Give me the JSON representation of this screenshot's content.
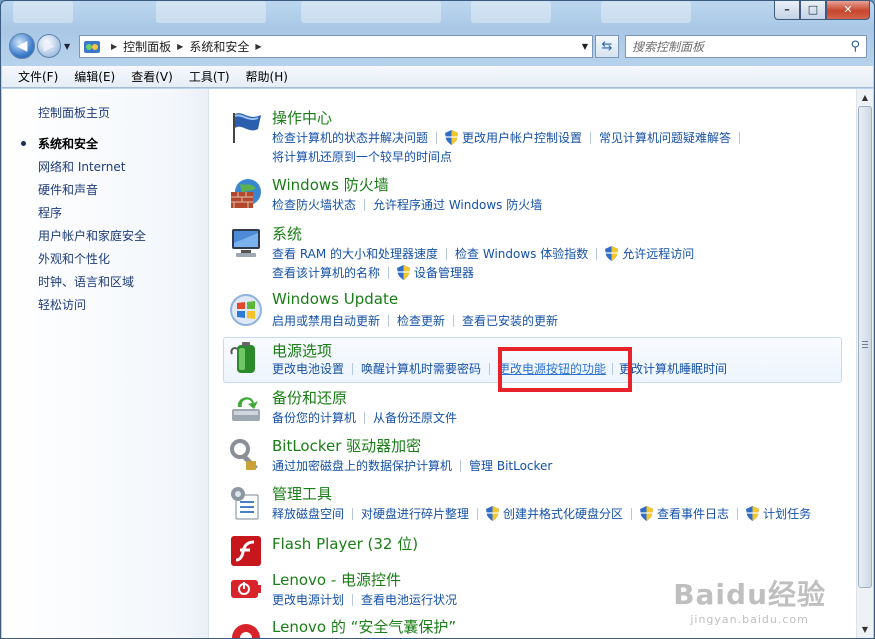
{
  "window": {
    "caption_buttons": {
      "minimize": "–",
      "maximize": "□",
      "close": "✕"
    }
  },
  "address_bar": {
    "crumbs": [
      "控制面板",
      "系统和安全"
    ]
  },
  "search": {
    "placeholder": "搜索控制面板"
  },
  "menu": [
    "文件(F)",
    "编辑(E)",
    "查看(V)",
    "工具(T)",
    "帮助(H)"
  ],
  "sidebar": {
    "home": "控制面板主页",
    "items": [
      {
        "label": "系统和安全",
        "current": true
      },
      {
        "label": "网络和 Internet"
      },
      {
        "label": "硬件和声音"
      },
      {
        "label": "程序"
      },
      {
        "label": "用户帐户和家庭安全"
      },
      {
        "label": "外观和个性化"
      },
      {
        "label": "时钟、语言和区域"
      },
      {
        "label": "轻松访问"
      }
    ]
  },
  "categories": [
    {
      "title": "操作中心",
      "icon": "flag-icon",
      "row1": [
        "检查计算机的状态并解决问题",
        "更改用户帐户控制设置",
        "常见计算机问题疑难解答"
      ],
      "row2": [
        "将计算机还原到一个较早的时间点"
      ]
    },
    {
      "title": "Windows 防火墙",
      "icon": "firewall-icon",
      "row1": [
        "检查防火墙状态",
        "允许程序通过 Windows 防火墙"
      ]
    },
    {
      "title": "系统",
      "icon": "computer-icon",
      "row1": [
        "查看 RAM 的大小和处理器速度",
        "检查 Windows 体验指数",
        "允许远程访问"
      ],
      "row2": [
        "查看该计算机的名称",
        "设备管理器"
      ]
    },
    {
      "title": "Windows Update",
      "icon": "windows-update-icon",
      "row1": [
        "启用或禁用自动更新",
        "检查更新",
        "查看已安装的更新"
      ]
    },
    {
      "title": "电源选项",
      "icon": "battery-icon",
      "row1": [
        "更改电池设置",
        "唤醒计算机时需要密码",
        "更改电源按钮的功能",
        "更改计算机睡眠时间"
      ]
    },
    {
      "title": "备份和还原",
      "icon": "backup-icon",
      "row1": [
        "备份您的计算机",
        "从备份还原文件"
      ]
    },
    {
      "title": "BitLocker 驱动器加密",
      "icon": "bitlocker-key-icon",
      "row1": [
        "通过加密磁盘上的数据保护计算机",
        "管理 BitLocker"
      ]
    },
    {
      "title": "管理工具",
      "icon": "admin-tools-icon",
      "row1": [
        "释放磁盘空间",
        "对硬盘进行碎片整理",
        "创建并格式化硬盘分区",
        "查看事件日志",
        "计划任务"
      ]
    },
    {
      "title": "Flash Player (32 位)",
      "icon": "flash-icon"
    },
    {
      "title": "Lenovo - 电源控件",
      "icon": "lenovo-power-icon",
      "row1": [
        "更改电源计划",
        "查看电池运行状况"
      ]
    },
    {
      "title": "Lenovo 的 “安全气囊保护”",
      "icon": "lenovo-airbag-icon"
    }
  ],
  "watermark": {
    "logo": "Baidu经验",
    "url": "jingyan.baidu.com"
  },
  "colors": {
    "link": "#1551a8",
    "title": "#1a7d16",
    "highlight_box": "#e8222a"
  }
}
